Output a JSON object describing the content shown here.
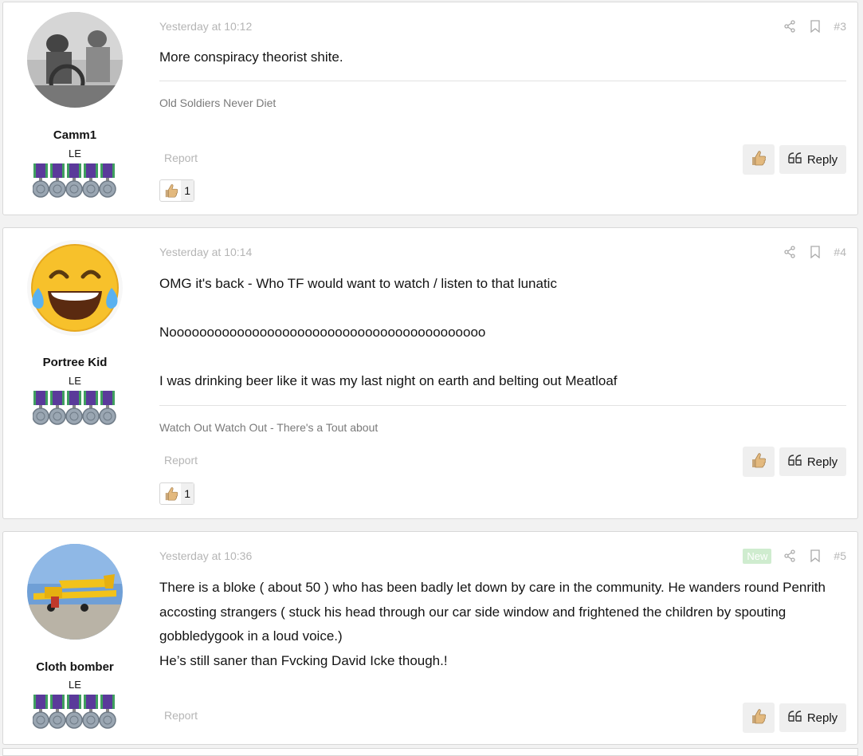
{
  "posts": [
    {
      "username": "Camm1",
      "user_title": "LE",
      "date": "Yesterday at 10:12",
      "number": "#3",
      "new_badge": "",
      "body": [
        "More conspiracy theorist shite."
      ],
      "signature": "Old Soldiers Never Diet",
      "report_label": "Report",
      "reply_label": "Reply",
      "reaction_count": "1",
      "avatar_icon": "vintage-photo-avatar"
    },
    {
      "username": "Portree Kid",
      "user_title": "LE",
      "date": "Yesterday at 10:14",
      "number": "#4",
      "new_badge": "",
      "body": [
        "OMG it's back - Who TF would want to watch / listen to that lunatic",
        "",
        "Noooooooooooooooooooooooooooooooooooooooooo",
        "",
        "I was drinking beer like it was my last night on earth and belting out Meatloaf"
      ],
      "signature": "Watch Out Watch Out - There's a Tout about",
      "report_label": "Report",
      "reply_label": "Reply",
      "reaction_count": "1",
      "avatar_icon": "laughing-crying-emoji-avatar"
    },
    {
      "username": "Cloth bomber",
      "user_title": "LE",
      "date": "Yesterday at 10:36",
      "number": "#5",
      "new_badge": "New",
      "body": [
        "There is a bloke ( about 50 ) who has been badly let down by care in the community. He wanders round Penrith",
        "accosting strangers ( stuck his head through our car side window and frightened the children by spouting",
        "gobbledygook in a loud voice.)",
        "He’s still saner than Fvcking David Icke though.!"
      ],
      "signature": "",
      "report_label": "Report",
      "reply_label": "Reply",
      "reaction_count": "",
      "avatar_icon": "yellow-plane-avatar"
    }
  ],
  "colors": {
    "medal_ribbon_purple": "#5a3a9a",
    "medal_ribbon_green": "#3f9f5f",
    "medal_silver": "#9aa6b2",
    "new_badge": "#cfeccf"
  }
}
